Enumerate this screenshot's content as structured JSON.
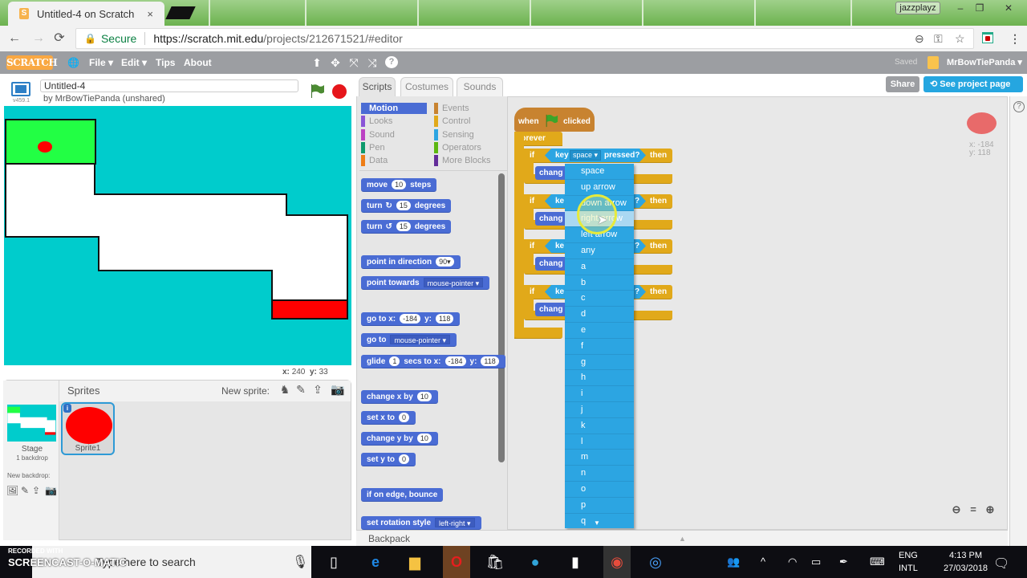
{
  "browser": {
    "tab_title": "Untitled-4 on Scratch",
    "tab_close": "×",
    "profile_name": "jazzplayz",
    "window_controls": {
      "minimize": "–",
      "restore": "❐",
      "close": "✕"
    },
    "nav": {
      "back": "←",
      "forward": "→",
      "reload": "⟳"
    },
    "secure_label": "Secure",
    "url_scheme_host": "https://scratch.mit.edu",
    "url_path": "/projects/212671521/#editor",
    "omnibox_icons": {
      "zoom": "⊖",
      "key": "⚿",
      "star": "☆",
      "menu": "⋮"
    }
  },
  "scratch_menu": {
    "logo": "SCRATCH",
    "globe": "🌐",
    "items": [
      "File ▾",
      "Edit ▾",
      "Tips",
      "About"
    ],
    "tools": [
      "⬆",
      "✥",
      "⤧",
      "⤨",
      "?"
    ],
    "saved_label": "Saved",
    "username": "MrBowTiePanda ▾"
  },
  "project": {
    "title": "Untitled-4",
    "author_line": "by MrBowTiePanda (unshared)",
    "version": "v459.1",
    "share_label": "Share",
    "see_project_label": "See project page"
  },
  "stage": {
    "mouse_x_label": "x:",
    "mouse_x": "240",
    "mouse_y_label": "y:",
    "mouse_y": "33",
    "colors": {
      "background": "#00cccc",
      "start": "#22ff44",
      "path": "#ffffff",
      "goal": "#ff0000",
      "sprite": "#ff0000"
    }
  },
  "sprites_pane": {
    "title": "Sprites",
    "new_sprite_label": "New sprite:",
    "stage_label": "Stage",
    "stage_sub": "1 backdrop",
    "new_backdrop_label": "New backdrop:",
    "sprites": [
      {
        "name": "Sprite1",
        "selected": true
      }
    ]
  },
  "editor_tabs": [
    "Scripts",
    "Costumes",
    "Sounds"
  ],
  "categories": [
    {
      "name": "Motion",
      "color": "#4a6cd4",
      "active": true
    },
    {
      "name": "Looks",
      "color": "#8a55d7"
    },
    {
      "name": "Sound",
      "color": "#bb42c3"
    },
    {
      "name": "Pen",
      "color": "#0e9a6c"
    },
    {
      "name": "Data",
      "color": "#ee7d16"
    },
    {
      "name": "Events",
      "color": "#c88330"
    },
    {
      "name": "Control",
      "color": "#e1a91a"
    },
    {
      "name": "Sensing",
      "color": "#2ca5e2"
    },
    {
      "name": "Operators",
      "color": "#5cb712"
    },
    {
      "name": "More Blocks",
      "color": "#632d99"
    }
  ],
  "palette_blocks": {
    "move": {
      "a": "move",
      "v": "10",
      "b": "steps"
    },
    "turn_cw": {
      "a": "turn",
      "icon": "↻",
      "v": "15",
      "b": "degrees"
    },
    "turn_ccw": {
      "a": "turn",
      "icon": "↺",
      "v": "15",
      "b": "degrees"
    },
    "point_dir": {
      "a": "point in direction",
      "v": "90▾"
    },
    "point_towards": {
      "a": "point towards",
      "v": "mouse-pointer ▾"
    },
    "goto_xy": {
      "a": "go to x:",
      "x": "-184",
      "b": "y:",
      "y": "118"
    },
    "goto": {
      "a": "go to",
      "v": "mouse-pointer ▾"
    },
    "glide": {
      "a": "glide",
      "s": "1",
      "b": "secs to x:",
      "x": "-184",
      "c": "y:",
      "y": "118"
    },
    "change_x": {
      "a": "change x by",
      "v": "10"
    },
    "set_x": {
      "a": "set x to",
      "v": "0"
    },
    "change_y": {
      "a": "change y by",
      "v": "10"
    },
    "set_y": {
      "a": "set y to",
      "v": "0"
    },
    "bounce": {
      "a": "if on edge, bounce"
    },
    "rotation_style": {
      "a": "set rotation style",
      "v": "left-right ▾"
    }
  },
  "script": {
    "hat_when": "when",
    "hat_clicked": "clicked",
    "forever": "forever",
    "if_label": "if",
    "then_label": "then",
    "key_label": "key",
    "key_value": "space ▾",
    "pressed_label": "pressed?",
    "key_partial": "ke",
    "pressed_partial": "?",
    "change_partial": "chang"
  },
  "key_dropdown": {
    "options": [
      "space",
      "up arrow",
      "down arrow",
      "right arrow",
      "left arrow",
      "any",
      "a",
      "b",
      "c",
      "d",
      "e",
      "f",
      "g",
      "h",
      "i",
      "j",
      "k",
      "l",
      "m",
      "n",
      "o",
      "p",
      "q"
    ],
    "hovered": "right arrow",
    "scroll_arrow": "▼"
  },
  "sprite_info": {
    "x": "x: -184",
    "y": "y: 118"
  },
  "zoom_controls": {
    "out": "⊖",
    "reset": "=",
    "in": "⊕"
  },
  "backpack_label": "Backpack",
  "help": "?",
  "taskbar": {
    "recorded_with": "RECORDED WITH",
    "brand": "SCREENCAST-O-MATIC",
    "search_placeholder": "Type here to search",
    "lang_top": "ENG",
    "lang_bottom": "INTL",
    "time": "4:13 PM",
    "date": "27/03/2018"
  }
}
